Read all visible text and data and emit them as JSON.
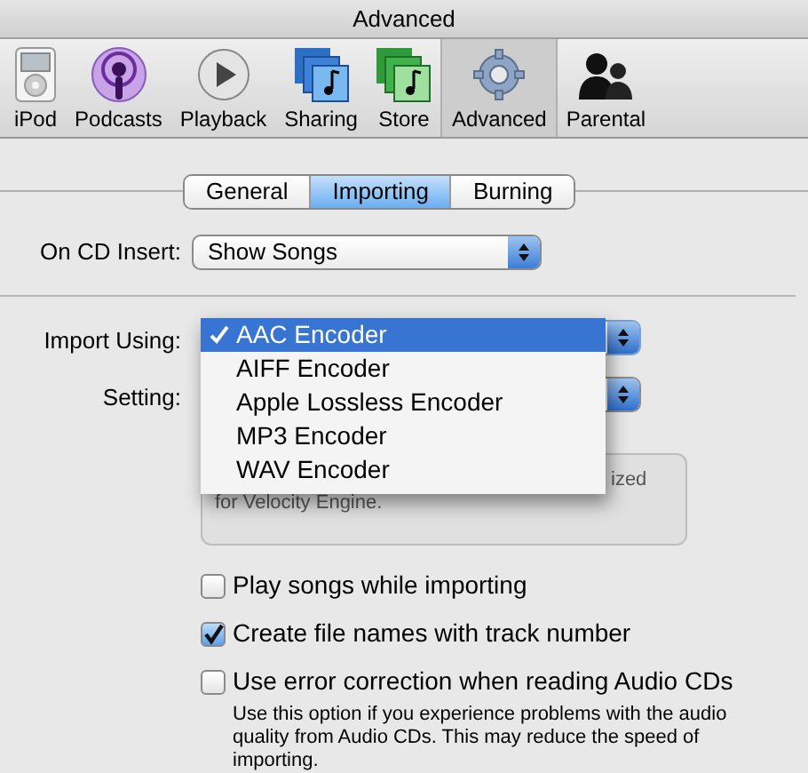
{
  "window": {
    "title": "Advanced"
  },
  "toolbar": {
    "items": [
      {
        "label": "iPod",
        "selected": false
      },
      {
        "label": "Podcasts",
        "selected": false
      },
      {
        "label": "Playback",
        "selected": false
      },
      {
        "label": "Sharing",
        "selected": false
      },
      {
        "label": "Store",
        "selected": false
      },
      {
        "label": "Advanced",
        "selected": true
      },
      {
        "label": "Parental",
        "selected": false
      }
    ]
  },
  "tabs": [
    {
      "label": "General",
      "selected": false
    },
    {
      "label": "Importing",
      "selected": true
    },
    {
      "label": "Burning",
      "selected": false
    }
  ],
  "cd_insert": {
    "label": "On CD Insert:",
    "value": "Show Songs"
  },
  "import_using": {
    "label": "Import Using:",
    "menu": [
      {
        "label": "AAC Encoder",
        "selected": true
      },
      {
        "label": "AIFF Encoder",
        "selected": false
      },
      {
        "label": "Apple Lossless Encoder",
        "selected": false
      },
      {
        "label": "MP3 Encoder",
        "selected": false
      },
      {
        "label": "WAV Encoder",
        "selected": false
      }
    ]
  },
  "setting": {
    "label": "Setting:"
  },
  "description": {
    "lines": [
      "ized",
      "for Velocity Engine."
    ]
  },
  "options": [
    {
      "label": "Play songs while importing",
      "checked": false
    },
    {
      "label": "Create file names with track number",
      "checked": true
    },
    {
      "label": "Use error correction when reading Audio CDs",
      "checked": false,
      "note": "Use this option if you experience problems with the audio quality from Audio CDs. This may reduce the speed of importing."
    }
  ]
}
